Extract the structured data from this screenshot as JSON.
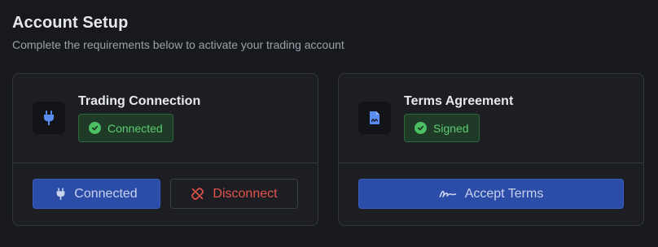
{
  "header": {
    "title": "Account Setup",
    "subtitle": "Complete the requirements below to activate your trading account"
  },
  "cards": [
    {
      "title": "Trading Connection",
      "icon": "plug-icon",
      "status": "Connected",
      "status_icon": "check-circle-icon",
      "buttons": [
        {
          "label": "Connected",
          "icon": "plug-icon"
        },
        {
          "label": "Disconnect",
          "icon": "unlink-icon"
        }
      ]
    },
    {
      "title": "Terms Agreement",
      "icon": "document-signature-icon",
      "status": "Signed",
      "status_icon": "check-circle-icon",
      "buttons": [
        {
          "label": "Accept Terms",
          "icon": "signature-icon"
        }
      ]
    }
  ],
  "colors": {
    "background": "#17191d",
    "card": "#1c1e23",
    "primary": "#2b4ca7",
    "success": "#5ccc71",
    "danger": "#e5534b",
    "icon_accent": "#5a8df0"
  }
}
